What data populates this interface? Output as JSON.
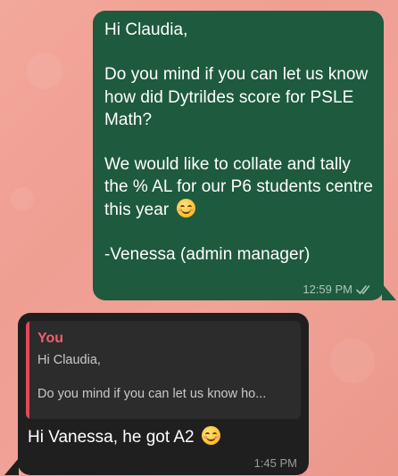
{
  "outgoing": {
    "text_before_emoji": "Hi Claudia,\n\nDo you mind if you can let us know how did Dytrildes score for PSLE Math?\n\nWe would like to collate and tally the % AL for our P6 students centre this year ",
    "emoji": "smiling-face-with-smiling-eyes",
    "signature": "-Venessa (admin manager)",
    "time": "12:59 PM",
    "status": "read"
  },
  "incoming": {
    "quoted": {
      "sender": "You",
      "line1": "Hi Claudia,",
      "line2": "Do you mind if you can let us know ho..."
    },
    "text": "Hi Vanessa, he got A2 ",
    "emoji": "smiling-face",
    "time": "1:45 PM"
  },
  "colors": {
    "outgoing_bubble": "#1e5a3e",
    "incoming_bubble": "#1f1f1f",
    "quote_accent": "#e2475a",
    "wallpaper": "#f0a397"
  }
}
